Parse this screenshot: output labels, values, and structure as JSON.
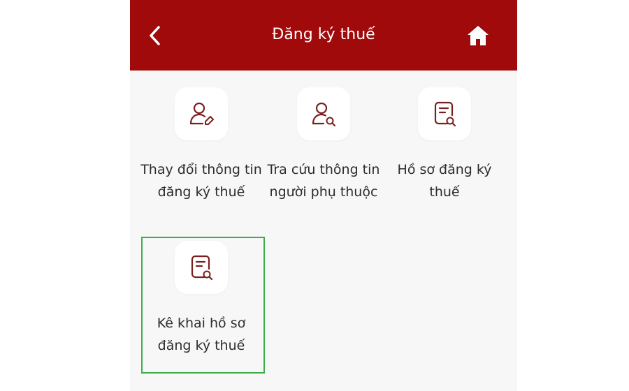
{
  "header": {
    "title": "Đăng ký thuế",
    "back_icon": "chevron-left-icon",
    "home_icon": "home-icon",
    "background": "#a10a0a"
  },
  "menu": {
    "items": [
      {
        "label": "Thay đổi thông tin đăng ký thuế",
        "icon": "user-edit-icon"
      },
      {
        "label": "Tra cứu thông tin người phụ thuộc",
        "icon": "user-search-icon"
      },
      {
        "label": "Hồ sơ đăng ký thuế",
        "icon": "document-search-icon"
      },
      {
        "label": "Kê khai hồ sơ đăng ký thuế",
        "icon": "document-search-icon",
        "highlighted": true
      }
    ],
    "icon_color": "#7a1f1f",
    "highlight_color": "#3fae4a"
  }
}
